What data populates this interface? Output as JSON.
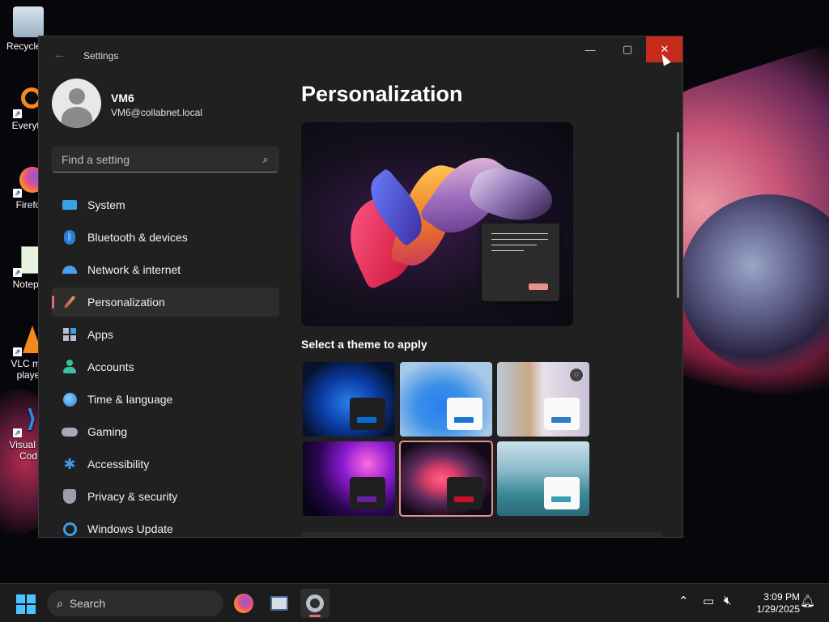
{
  "desktop": {
    "icons": [
      {
        "label": "Recycle B",
        "icon": "recycle-bin-icon"
      },
      {
        "label": "Everyth",
        "icon": "everything-search-icon"
      },
      {
        "label": "Firefo",
        "icon": "firefox-icon"
      },
      {
        "label": "Notepa",
        "icon": "notepad-icon"
      },
      {
        "label": "VLC me",
        "label2": "playe",
        "icon": "vlc-icon"
      },
      {
        "label": "Visual St",
        "label2": "Cod",
        "icon": "vscode-icon"
      }
    ]
  },
  "window": {
    "title": "Settings",
    "back_icon": "←",
    "minimize": "—",
    "maximize": "▢",
    "close": "✕"
  },
  "user": {
    "name": "VM6",
    "email": "VM6@collabnet.local"
  },
  "search": {
    "placeholder": "Find a setting",
    "icon": "⌕"
  },
  "nav": {
    "items": [
      {
        "label": "System",
        "icon": "system-icon",
        "color": "#3aa0e8"
      },
      {
        "label": "Bluetooth & devices",
        "icon": "bluetooth-icon",
        "color": "#3a8ee8"
      },
      {
        "label": "Network & internet",
        "icon": "wifi-icon",
        "color": "#4aa0f0"
      },
      {
        "label": "Personalization",
        "icon": "brush-icon",
        "color": "#e0a060",
        "active": true
      },
      {
        "label": "Apps",
        "icon": "apps-icon",
        "color": "#b0b8c8"
      },
      {
        "label": "Accounts",
        "icon": "accounts-icon",
        "color": "#3ac0a0"
      },
      {
        "label": "Time & language",
        "icon": "globe-clock-icon",
        "color": "#3aa0e8"
      },
      {
        "label": "Gaming",
        "icon": "gamepad-icon",
        "color": "#a8a8b8"
      },
      {
        "label": "Accessibility",
        "icon": "accessibility-icon",
        "color": "#3a9ae8"
      },
      {
        "label": "Privacy & security",
        "icon": "shield-icon",
        "color": "#9aa0aa"
      },
      {
        "label": "Windows Update",
        "icon": "update-icon",
        "color": "#3aa0e8"
      }
    ]
  },
  "main": {
    "title": "Personalization",
    "theme_heading": "Select a theme to apply",
    "themes": [
      {
        "name": "windows-dark",
        "accent": "#0a6cd0",
        "selected": false
      },
      {
        "name": "windows-light",
        "accent": "#1a78d0",
        "selected": false
      },
      {
        "name": "windows-spotlight",
        "accent": "#2a7ec8",
        "selected": false,
        "badge": "spotlight"
      },
      {
        "name": "glow",
        "accent": "#6a20a0",
        "selected": false
      },
      {
        "name": "captured-motion",
        "accent": "#c8102e",
        "selected": true
      },
      {
        "name": "flow",
        "accent": "#3a9ab0",
        "selected": false
      }
    ]
  },
  "taskbar": {
    "search_label": "Search",
    "apps": [
      "firefox-icon",
      "network-computer-icon",
      "settings-gear-icon"
    ],
    "time": "3:09 PM",
    "date": "1/29/2025"
  }
}
